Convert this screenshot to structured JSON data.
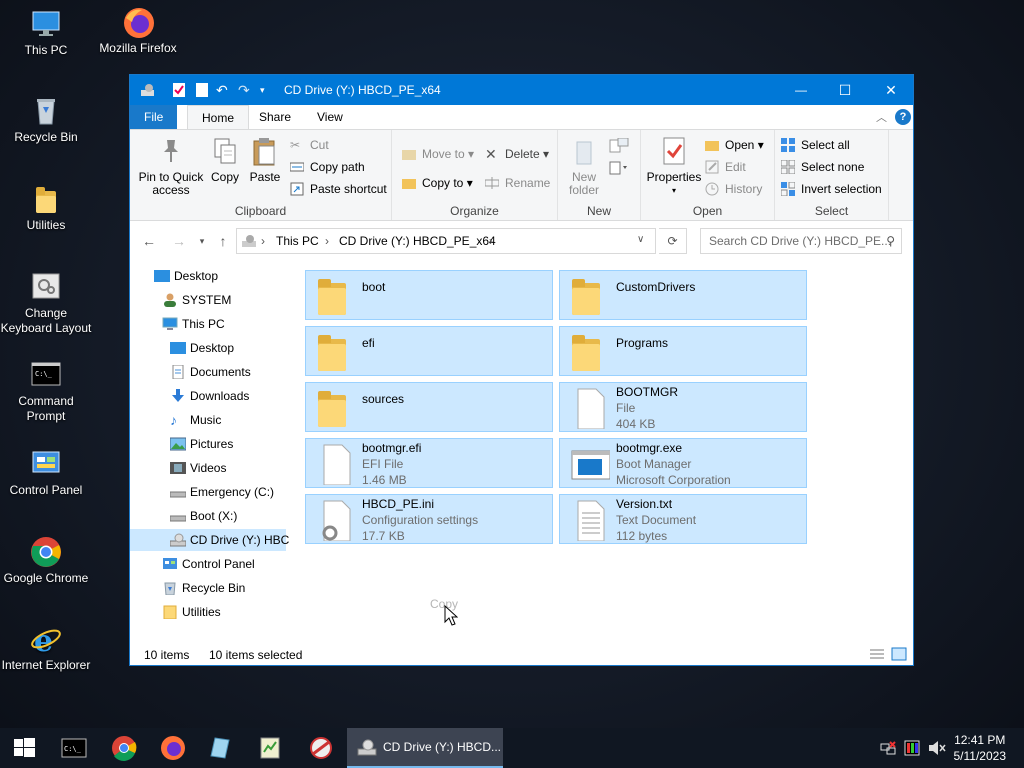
{
  "desktop": {
    "icons": [
      {
        "label": "This PC"
      },
      {
        "label": "Mozilla Firefox"
      },
      {
        "label": "Recycle Bin"
      },
      {
        "label": "Utilities"
      },
      {
        "label": "Change Keyboard Layout"
      },
      {
        "label": "Command Prompt"
      },
      {
        "label": "Control Panel"
      },
      {
        "label": "Google Chrome"
      },
      {
        "label": "Internet Explorer"
      }
    ]
  },
  "window": {
    "title": "CD Drive (Y:) HBCD_PE_x64",
    "controls": {
      "minimize": "—",
      "maximize": "☐",
      "close": "✕"
    },
    "tabs": [
      {
        "label": "File"
      },
      {
        "label": "Home"
      },
      {
        "label": "Share"
      },
      {
        "label": "View"
      }
    ],
    "ribbon": {
      "clipboard": {
        "label": "Clipboard",
        "pin": "Pin to Quick access",
        "copy": "Copy",
        "paste": "Paste",
        "cut": "Cut",
        "copy_path": "Copy path",
        "paste_shortcut": "Paste shortcut"
      },
      "organize": {
        "label": "Organize",
        "move_to": "Move to",
        "copy_to": "Copy to",
        "delete": "Delete",
        "rename": "Rename"
      },
      "new": {
        "label": "New",
        "new_folder": "New folder"
      },
      "open": {
        "label": "Open",
        "properties": "Properties",
        "open": "Open",
        "edit": "Edit",
        "history": "History"
      },
      "select": {
        "label": "Select",
        "select_all": "Select all",
        "select_none": "Select none",
        "invert": "Invert selection"
      }
    },
    "address": {
      "crumbs": [
        "This PC",
        "CD Drive (Y:) HBCD_PE_x64"
      ],
      "search_placeholder": "Search CD Drive (Y:) HBCD_PE..."
    },
    "nav": [
      {
        "label": "Desktop"
      },
      {
        "label": "SYSTEM"
      },
      {
        "label": "This PC"
      },
      {
        "label": "Desktop"
      },
      {
        "label": "Documents"
      },
      {
        "label": "Downloads"
      },
      {
        "label": "Music"
      },
      {
        "label": "Pictures"
      },
      {
        "label": "Videos"
      },
      {
        "label": "Emergency (C:)"
      },
      {
        "label": "Boot (X:)"
      },
      {
        "label": "CD Drive (Y:) HBC"
      },
      {
        "label": "Control Panel"
      },
      {
        "label": "Recycle Bin"
      },
      {
        "label": "Utilities"
      }
    ],
    "files": [
      {
        "name": "boot",
        "l2": "",
        "l3": ""
      },
      {
        "name": "CustomDrivers",
        "l2": "",
        "l3": ""
      },
      {
        "name": "efi",
        "l2": "",
        "l3": ""
      },
      {
        "name": "Programs",
        "l2": "",
        "l3": ""
      },
      {
        "name": "sources",
        "l2": "",
        "l3": ""
      },
      {
        "name": "BOOTMGR",
        "l2": "File",
        "l3": "404 KB"
      },
      {
        "name": "bootmgr.efi",
        "l2": "EFI File",
        "l3": "1.46 MB"
      },
      {
        "name": "bootmgr.exe",
        "l2": "Boot Manager",
        "l3": "Microsoft Corporation"
      },
      {
        "name": "HBCD_PE.ini",
        "l2": "Configuration settings",
        "l3": "17.7 KB"
      },
      {
        "name": "Version.txt",
        "l2": "Text Document",
        "l3": "112 bytes"
      }
    ],
    "drag_hint": "Copy",
    "status": {
      "count": "10 items",
      "selected": "10 items selected"
    }
  },
  "taskbar": {
    "active_label": "CD Drive (Y:) HBCD...",
    "time": "12:41 PM",
    "date": "5/11/2023"
  },
  "colors": {
    "accent": "#0078d7",
    "selection": "#cce8ff",
    "taskbar": "#101722"
  }
}
